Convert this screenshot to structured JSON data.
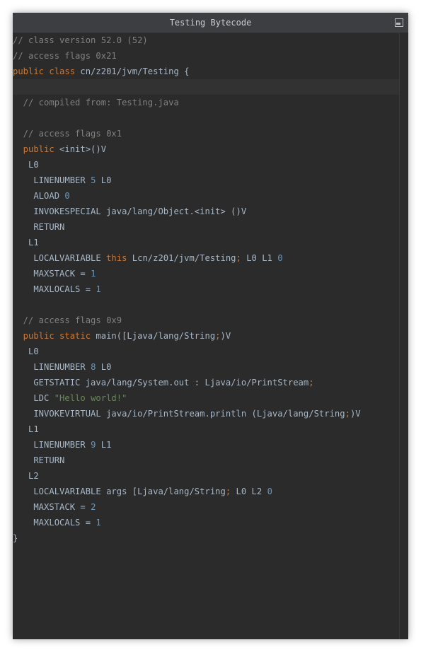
{
  "window": {
    "title": "Testing Bytecode"
  },
  "code": {
    "lines": [
      "// class version 52.0 (52)",
      "// access flags 0x21",
      [
        "public class",
        " cn/z201/jvm/Testing {"
      ],
      "",
      "  // compiled from: Testing.java",
      "",
      "  // access flags 0x1",
      [
        "  public",
        " <init>()V"
      ],
      "   L0",
      [
        "    LINENUMBER ",
        "5",
        " L0"
      ],
      [
        "    ALOAD ",
        "0"
      ],
      "    INVOKESPECIAL java/lang/Object.<init> ()V",
      "    RETURN",
      "   L1",
      [
        "    LOCALVARIABLE ",
        "this",
        " Lcn/z201/jvm/Testing",
        ";",
        " L0 L1 ",
        "0"
      ],
      [
        "    MAXSTACK = ",
        "1"
      ],
      [
        "    MAXLOCALS = ",
        "1"
      ],
      "",
      "  // access flags 0x9",
      [
        "  public static",
        " main([Ljava/lang/String",
        ";",
        ")V"
      ],
      "   L0",
      [
        "    LINENUMBER ",
        "8",
        " L0"
      ],
      [
        "    GETSTATIC java/lang/System.out : Ljava/io/PrintStream",
        ";"
      ],
      [
        "    LDC ",
        "\"Hello world!\""
      ],
      [
        "    INVOKEVIRTUAL java/io/PrintStream.println (Ljava/lang/String",
        ";",
        ")V"
      ],
      "   L1",
      [
        "    LINENUMBER ",
        "9",
        " L1"
      ],
      "    RETURN",
      "   L2",
      [
        "    LOCALVARIABLE args [Ljava/lang/String",
        ";",
        " L0 L2 ",
        "0"
      ],
      [
        "    MAXSTACK = ",
        "2"
      ],
      [
        "    MAXLOCALS = ",
        "1"
      ],
      "}"
    ]
  },
  "colors": {
    "background": "#2b2b2b",
    "comment": "#808080",
    "keyword": "#cc7832",
    "number": "#6897bb",
    "string": "#6a8759",
    "text": "#a9b7c6"
  }
}
